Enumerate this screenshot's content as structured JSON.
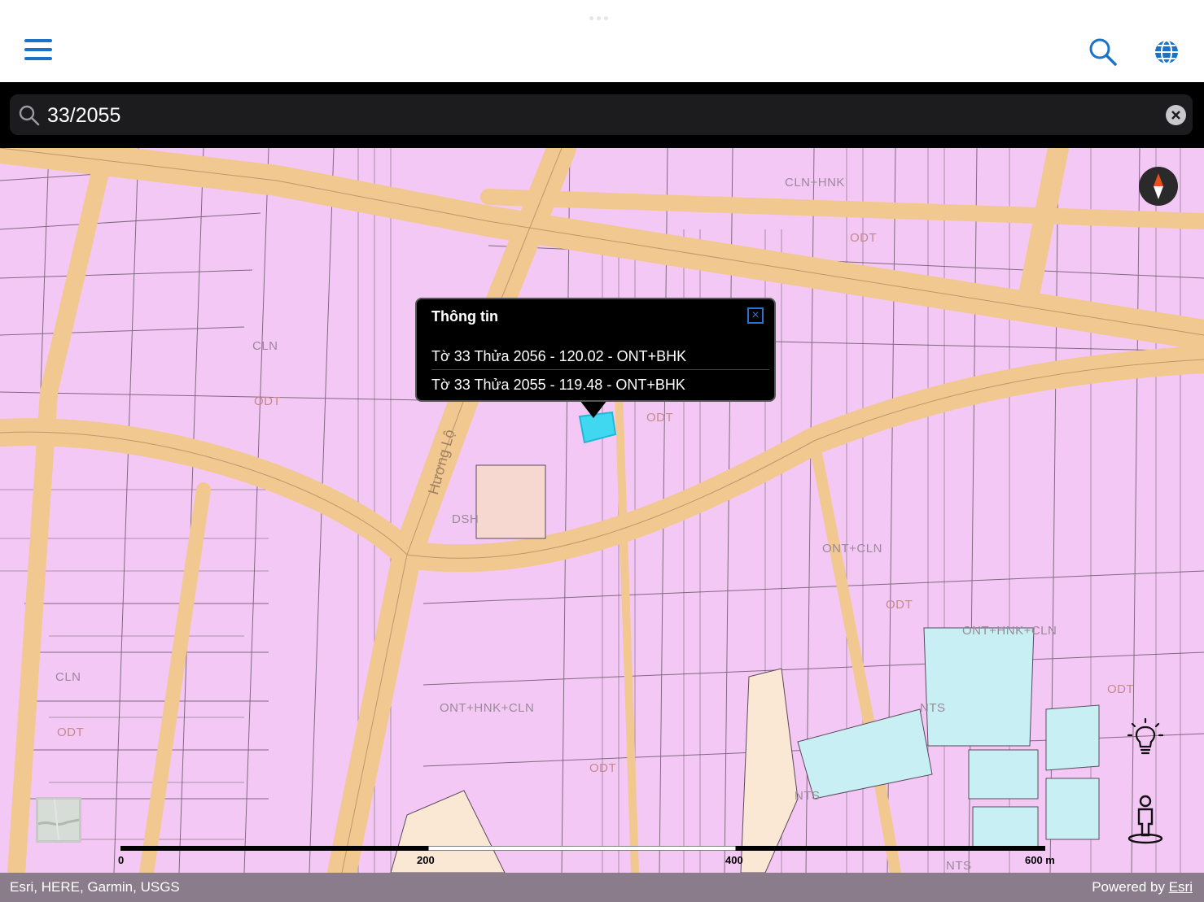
{
  "header": {
    "menu_icon": "hamburger-menu-icon",
    "search_icon": "search-icon",
    "globe_icon": "globe-icon",
    "accent_color": "#1b73c9"
  },
  "search": {
    "value": "33/2055",
    "clear_icon": "clear-icon"
  },
  "map": {
    "land_use_labels": [
      "CLN+HNK",
      "ODT",
      "CLN",
      "ODT",
      "ODT",
      "DSH",
      "ONT+CLN",
      "ODT",
      "ONT+HNK+CLN",
      "ODT",
      "CLN",
      "ODT",
      "ONT+HNK+CLN",
      "ODT",
      "NTS",
      "NTS",
      "NTS"
    ],
    "road_label": "Hương Lộ",
    "colors": {
      "residential": "#f4c8f4",
      "road": "#f0c890",
      "aquaculture": "#c8f0f4",
      "selected": "#40d8f0"
    }
  },
  "popup": {
    "title": "Thông tin",
    "rows": [
      "Tờ 33 Thửa 2056 - 120.02 - ONT+BHK",
      "Tờ 33 Thửa 2055 - 119.48 - ONT+BHK"
    ]
  },
  "controls": {
    "compass_icon": "compass-icon",
    "light_icon": "lightbulb-icon",
    "person_icon": "street-view-person-icon",
    "basemap_icon": "basemap-thumbnail-icon"
  },
  "scale": {
    "ticks": [
      "0",
      "200",
      "400",
      "600 m"
    ]
  },
  "attribution": {
    "left": "Esri, HERE, Garmin, USGS",
    "powered_prefix": "Powered by ",
    "powered_link": "Esri"
  }
}
